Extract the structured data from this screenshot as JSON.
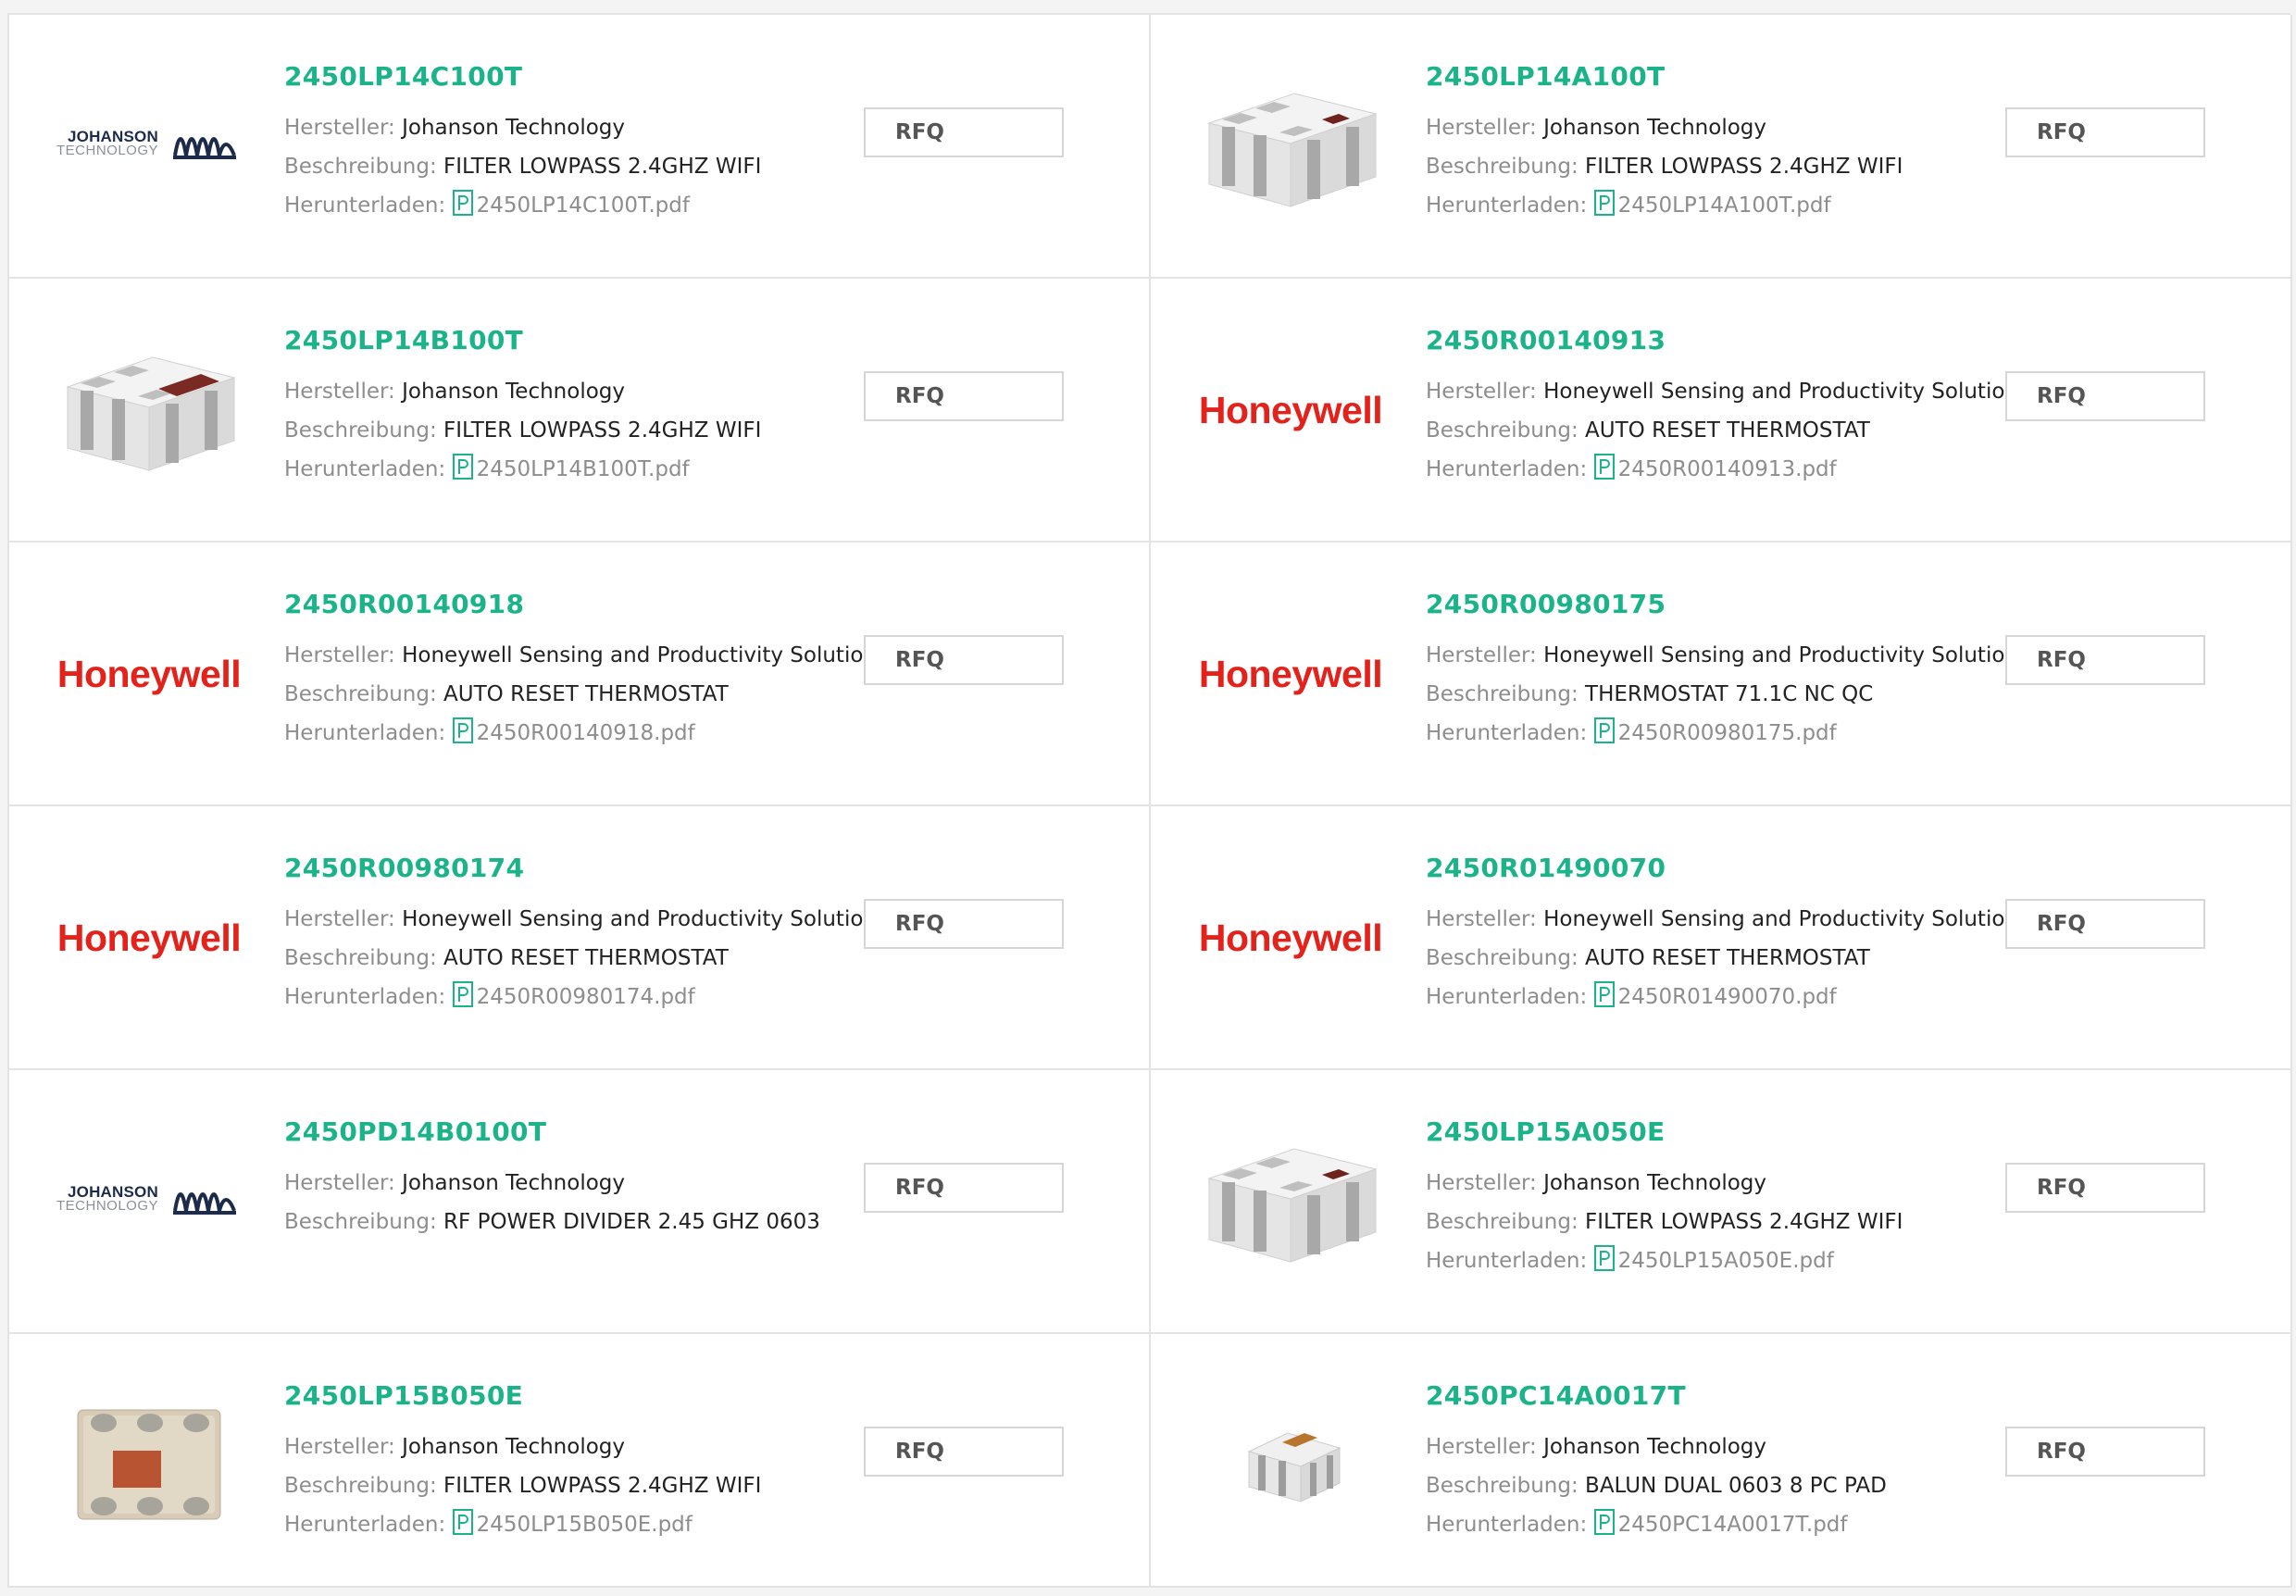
{
  "labels": {
    "manufacturer": "Hersteller:",
    "description": "Beschreibung:",
    "download": "Herunterladen:",
    "rfq": "RFQ"
  },
  "logos": {
    "honeywell": "Honeywell",
    "johanson_line1": "JOHANSON",
    "johanson_line2": "TECHNOLOGY"
  },
  "colors": {
    "part_number": "#1bb38a",
    "honeywell_red": "#e3231b",
    "label_gray": "#8d8d8d"
  },
  "products": [
    {
      "pn": "2450LP14C100T",
      "manufacturer": "Johanson Technology",
      "description": "FILTER LOWPASS 2.4GHZ WIFI",
      "file": "2450LP14C100T.pdf",
      "image": "johanson-logo"
    },
    {
      "pn": "2450LP14A100T",
      "manufacturer": "Johanson Technology",
      "description": "FILTER LOWPASS 2.4GHZ WIFI",
      "file": "2450LP14A100T.pdf",
      "image": "chip-filter-small-pad"
    },
    {
      "pn": "2450LP14B100T",
      "manufacturer": "Johanson Technology",
      "description": "FILTER LOWPASS 2.4GHZ WIFI",
      "file": "2450LP14B100T.pdf",
      "image": "chip-filter-large-pad"
    },
    {
      "pn": "2450R00140913",
      "manufacturer": "Honeywell Sensing and Productivity Solutions",
      "description": "AUTO RESET THERMOSTAT",
      "file": "2450R00140913.pdf",
      "image": "honeywell-logo"
    },
    {
      "pn": "2450R00140918",
      "manufacturer": "Honeywell Sensing and Productivity Solutions",
      "description": "AUTO RESET THERMOSTAT",
      "file": "2450R00140918.pdf",
      "image": "honeywell-logo"
    },
    {
      "pn": "2450R00980175",
      "manufacturer": "Honeywell Sensing and Productivity Solutions",
      "description": "THERMOSTAT 71.1C NC QC",
      "file": "2450R00980175.pdf",
      "image": "honeywell-logo"
    },
    {
      "pn": "2450R00980174",
      "manufacturer": "Honeywell Sensing and Productivity Solutions",
      "description": "AUTO RESET THERMOSTAT",
      "file": "2450R00980174.pdf",
      "image": "honeywell-logo"
    },
    {
      "pn": "2450R01490070",
      "manufacturer": "Honeywell Sensing and Productivity Solutions",
      "description": "AUTO RESET THERMOSTAT",
      "file": "2450R01490070.pdf",
      "image": "honeywell-logo"
    },
    {
      "pn": "2450PD14B0100T",
      "manufacturer": "Johanson Technology",
      "description": "RF POWER DIVIDER 2.45 GHZ 0603",
      "file": "",
      "image": "johanson-logo"
    },
    {
      "pn": "2450LP15A050E",
      "manufacturer": "Johanson Technology",
      "description": "FILTER LOWPASS 2.4GHZ WIFI",
      "file": "2450LP15A050E.pdf",
      "image": "chip-filter-small-pad"
    },
    {
      "pn": "2450LP15B050E",
      "manufacturer": "Johanson Technology",
      "description": "FILTER LOWPASS 2.4GHZ WIFI",
      "file": "2450LP15B050E.pdf",
      "image": "chip-top-view"
    },
    {
      "pn": "2450PC14A0017T",
      "manufacturer": "Johanson Technology",
      "description": "BALUN DUAL 0603 8 PC PAD",
      "file": "2450PC14A0017T.pdf",
      "image": "chip-balun"
    }
  ]
}
